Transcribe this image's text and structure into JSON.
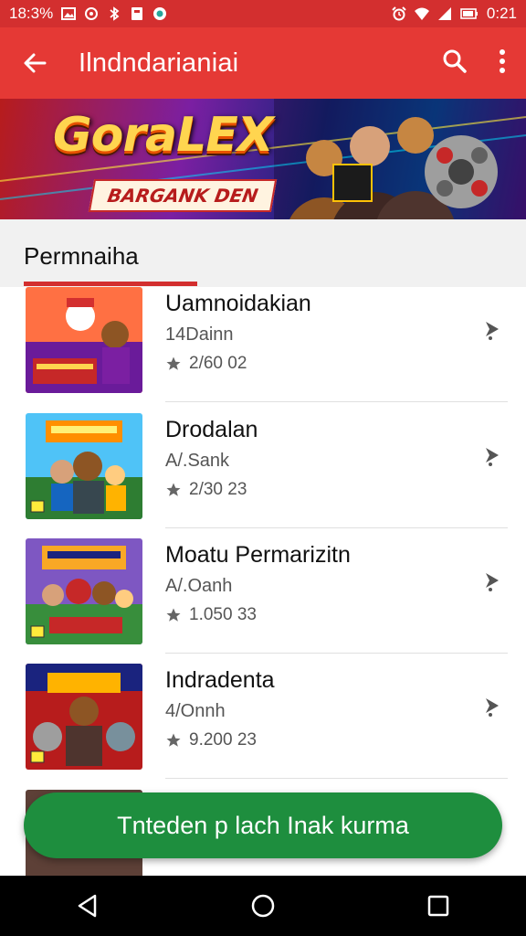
{
  "status_bar": {
    "time_left": "18:3%",
    "time_right": "0:21"
  },
  "app_bar": {
    "title": "Ilndndarianiai"
  },
  "banner": {
    "title": "GoraLEX",
    "subtitle": "BARGANK DEN"
  },
  "tab": {
    "label": "Permnaiha"
  },
  "list": [
    {
      "title": "Uamnoidakian",
      "subtitle": "14Dainn",
      "rating": "2/60 02"
    },
    {
      "title": "Drodalan",
      "subtitle": "A/.Sank",
      "rating": "2/30 23"
    },
    {
      "title": "Moatu Permarizitn",
      "subtitle": "A/.Oanh",
      "rating": "1.050 33"
    },
    {
      "title": "Indradenta",
      "subtitle": "4/Onnh",
      "rating": "9.200 23"
    }
  ],
  "fab": {
    "label": "Tnteden p lach Inak kurma"
  },
  "colors": {
    "appbar": "#e53935",
    "statusbar": "#d32f2f",
    "fab": "#1e8e3e"
  }
}
